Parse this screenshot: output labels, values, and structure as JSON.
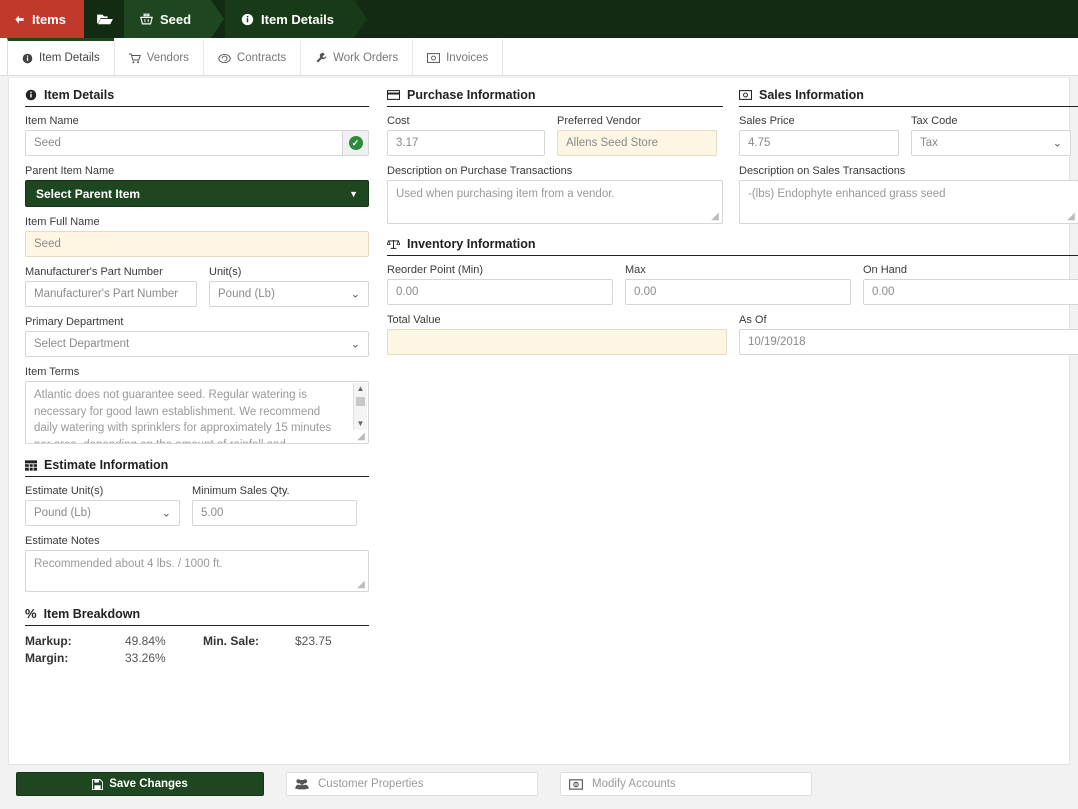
{
  "breadcrumb": {
    "back_label": "Items",
    "back_icon": "arrow-left-icon",
    "folder_icon": "folder-open-icon",
    "segments": [
      {
        "label": "Seed",
        "icon": "basket-icon"
      },
      {
        "label": "Item Details",
        "icon": "info-circle-icon"
      }
    ]
  },
  "tabs": [
    {
      "label": "Item Details",
      "icon": "info-circle-icon",
      "active": true
    },
    {
      "label": "Vendors",
      "icon": "cart-icon",
      "active": false
    },
    {
      "label": "Contracts",
      "icon": "contract-icon",
      "active": false
    },
    {
      "label": "Work Orders",
      "icon": "wrench-icon",
      "active": false
    },
    {
      "label": "Invoices",
      "icon": "money-bill-icon",
      "active": false
    }
  ],
  "item_details": {
    "section_title": "Item Details",
    "section_icon": "info-circle-icon",
    "item_name_label": "Item Name",
    "item_name_value": "Seed",
    "item_name_valid_icon": "check-circle-icon",
    "parent_item_label": "Parent Item Name",
    "parent_item_value": "Select Parent Item",
    "item_full_name_label": "Item Full Name",
    "item_full_name_value": "Seed",
    "mfr_part_label": "Manufacturer's Part Number",
    "mfr_part_placeholder": "Manufacturer's Part Number",
    "units_label": "Unit(s)",
    "units_value": "Pound (Lb)",
    "primary_dept_label": "Primary Department",
    "primary_dept_value": "Select Department",
    "item_terms_label": "Item Terms",
    "item_terms_value": "Atlantic does not guarantee seed.  Regular watering is necessary for good lawn establishment.  We recommend daily watering with sprinklers for approximately 15 minutes per area, depending on the amount of rainfall and temperature. Letting areas slightly dry between watering helps"
  },
  "estimate_information": {
    "section_title": "Estimate Information",
    "section_icon": "table-icon",
    "estimate_units_label": "Estimate Unit(s)",
    "estimate_units_value": "Pound (Lb)",
    "min_sales_qty_label": "Minimum Sales Qty.",
    "min_sales_qty_value": "5.00",
    "estimate_notes_label": "Estimate Notes",
    "estimate_notes_value": "Recommended about 4 lbs. / 1000 ft."
  },
  "item_breakdown": {
    "section_title": "Item Breakdown",
    "section_icon": "percent-icon",
    "rows": [
      {
        "label": "Markup:",
        "value": "49.84%",
        "label2": "Min. Sale:",
        "value2": "$23.75"
      },
      {
        "label": "Margin:",
        "value": "33.26%",
        "label2": "",
        "value2": ""
      }
    ]
  },
  "purchase_information": {
    "section_title": "Purchase Information",
    "section_icon": "credit-card-icon",
    "cost_label": "Cost",
    "cost_value": "3.17",
    "preferred_vendor_label": "Preferred Vendor",
    "preferred_vendor_value": "Allens Seed Store",
    "desc_purchase_label": "Description on Purchase Transactions",
    "desc_purchase_value": "Used when purchasing item from a vendor."
  },
  "inventory_information": {
    "section_title": "Inventory Information",
    "section_icon": "balance-scale-icon",
    "reorder_label": "Reorder Point (Min)",
    "reorder_value": "0.00",
    "max_label": "Max",
    "max_value": "0.00",
    "on_hand_label": "On Hand",
    "on_hand_value": "0.00",
    "total_value_label": "Total Value",
    "total_value_value": "",
    "as_of_label": "As Of",
    "as_of_value": "10/19/2018"
  },
  "sales_information": {
    "section_title": "Sales Information",
    "section_icon": "money-bill-icon",
    "sales_price_label": "Sales Price",
    "sales_price_value": "4.75",
    "tax_code_label": "Tax Code",
    "tax_code_value": "Tax",
    "desc_sales_label": "Description on Sales Transactions",
    "desc_sales_value": "-(lbs) Endophyte enhanced grass seed"
  },
  "footer": {
    "save_label": "Save Changes",
    "save_icon": "save-icon",
    "customer_properties_label": "Customer Properties",
    "customer_properties_icon": "users-icon",
    "modify_accounts_label": "Modify Accounts",
    "modify_accounts_icon": "money-icon"
  },
  "colors": {
    "brand_green": "#1e4620",
    "dark_green_bar": "#122b12",
    "back_red": "#c0392b",
    "cream_field": "#fdf6e3",
    "valid_green": "#2e8b3d"
  }
}
